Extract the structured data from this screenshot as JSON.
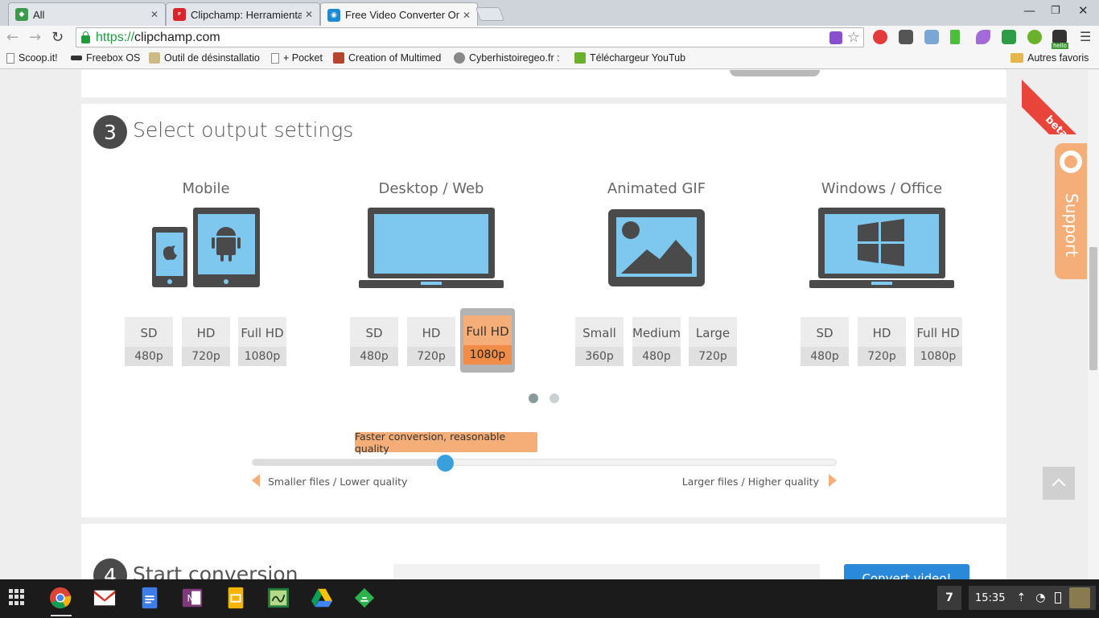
{
  "browser": {
    "tabs": [
      {
        "title": "All",
        "favicon_color": "#3c9a4a"
      },
      {
        "title": "Clipchamp: Herramientas",
        "favicon_color": "#d8262c",
        "favicon_text": "PUNTO GEEK"
      },
      {
        "title": "Free Video Converter Onl",
        "favicon_color": "#1a8ad4",
        "active": true
      }
    ],
    "url_scheme": "https://",
    "url_host": "clipchamp.com",
    "bookmarks": [
      {
        "label": "Scoop.it!"
      },
      {
        "label": "Freebox OS"
      },
      {
        "label": "Outil de désinstallatio"
      },
      {
        "label": "+ Pocket"
      },
      {
        "label": "Creation of Multimed"
      },
      {
        "label": "Cyberhistoiregeo.fr :"
      },
      {
        "label": "Téléchargeur YouTub"
      }
    ],
    "other_bookmarks": "Autres favoris",
    "ext_badge": "hello"
  },
  "section3": {
    "number": "3",
    "title": "Select output settings",
    "categories": [
      {
        "name": "Mobile",
        "options": [
          {
            "l1": "SD",
            "l2": "480p"
          },
          {
            "l1": "HD",
            "l2": "720p"
          },
          {
            "l1": "Full HD",
            "l2": "1080p"
          }
        ]
      },
      {
        "name": "Desktop / Web",
        "options": [
          {
            "l1": "SD",
            "l2": "480p"
          },
          {
            "l1": "HD",
            "l2": "720p"
          },
          {
            "l1": "Full HD",
            "l2": "1080p"
          }
        ],
        "selected_index": 2
      },
      {
        "name": "Animated GIF",
        "options": [
          {
            "l1": "Small",
            "l2": "360p"
          },
          {
            "l1": "Medium",
            "l2": "480p"
          },
          {
            "l1": "Large",
            "l2": "720p"
          }
        ]
      },
      {
        "name": "Windows / Office",
        "options": [
          {
            "l1": "SD",
            "l2": "480p"
          },
          {
            "l1": "HD",
            "l2": "720p"
          },
          {
            "l1": "Full HD",
            "l2": "1080p"
          }
        ]
      }
    ],
    "carousel_active": 0,
    "slider": {
      "tooltip": "Faster conversion, reasonable quality",
      "value": 0.33,
      "left_label": "Smaller files / Lower quality",
      "right_label": "Larger files / Higher quality"
    }
  },
  "section4": {
    "number": "4",
    "title": "Start conversion",
    "button": "Convert video!"
  },
  "badges": {
    "beta": "beta",
    "support": "Support"
  },
  "shelf": {
    "notification_count": "7",
    "clock": "15:35"
  },
  "colors": {
    "accent_orange": "#f6ae78",
    "selected_orange": "#f08c45",
    "slider_blue": "#3aa0dc",
    "device_gray": "#4a4a4a",
    "screen_blue": "#7ec7ee"
  }
}
